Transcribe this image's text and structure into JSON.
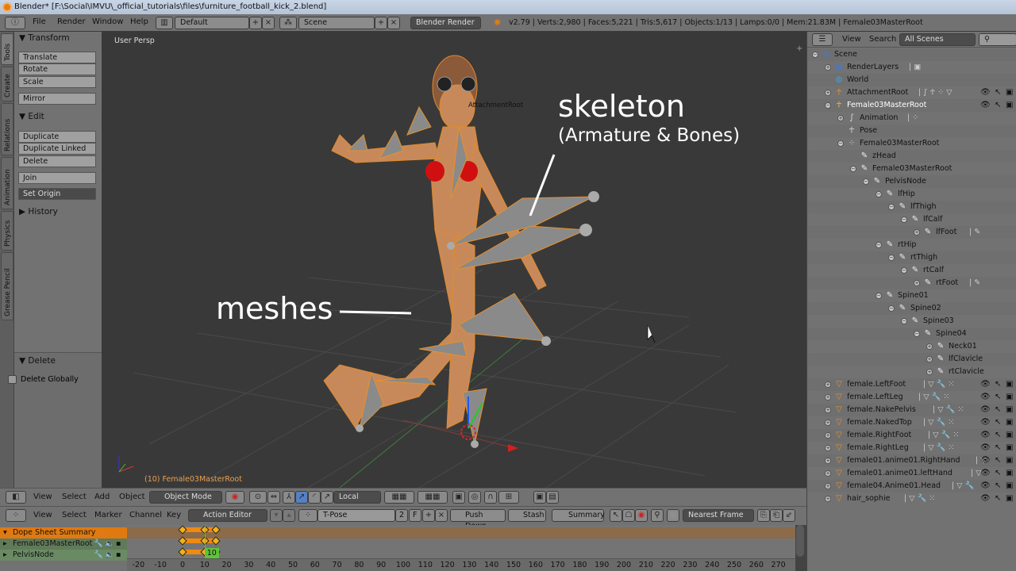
{
  "window": {
    "title": "Blender* [F:\\Social\\IMVU\\_official_tutorials\\files\\furniture_football_kick_2.blend]"
  },
  "infobar": {
    "menus": [
      "File",
      "Render",
      "Window",
      "Help"
    ],
    "screen_layout": "Default",
    "scene": "Scene",
    "render_engine": "Blender Render",
    "stats": "v2.79 | Verts:2,980 | Faces:5,221 | Tris:5,617 | Objects:1/13 | Lamps:0/0 | Mem:21.83M | Female03MasterRoot"
  },
  "tabs": [
    "Tools",
    "Create",
    "Relations",
    "Animation",
    "Physics",
    "Grease Pencil"
  ],
  "toolshelf": {
    "transform": {
      "title": "Transform",
      "buttons": [
        "Translate",
        "Rotate",
        "Scale"
      ],
      "mirror": "Mirror"
    },
    "edit": {
      "title": "Edit",
      "buttons": [
        "Duplicate",
        "Duplicate Linked",
        "Delete"
      ],
      "join": "Join",
      "set_origin": "Set Origin"
    },
    "history": {
      "title": "History"
    },
    "operator": {
      "title": "Delete",
      "checkbox_label": "Delete Globally",
      "checked": false
    }
  },
  "viewport": {
    "view_label": "User Persp",
    "object_label": "(10) Female03MasterRoot",
    "attachment_label": "AttachmentRoot",
    "annotations": {
      "skeleton": "skeleton",
      "skeleton_sub": "(Armature & Bones)",
      "meshes": "meshes"
    }
  },
  "view3d_header": {
    "menus": [
      "View",
      "Select",
      "Add",
      "Object"
    ],
    "mode": "Object Mode",
    "orientation": "Local"
  },
  "dopesheet_header": {
    "menus": [
      "View",
      "Select",
      "Marker",
      "Channel",
      "Key"
    ],
    "mode": "Action Editor",
    "action": "T-Pose",
    "users": "2",
    "fake_user": "F",
    "push_down": "Push Down",
    "stash": "Stash",
    "summary": "Summary",
    "snap": "Nearest Frame"
  },
  "dopesheet": {
    "channels": [
      {
        "name": "Dope Sheet Summary",
        "kind": "summary"
      },
      {
        "name": "Female03MasterRoot",
        "kind": "object"
      },
      {
        "name": "PelvisNode",
        "kind": "group"
      }
    ],
    "keyframes": [
      0,
      10,
      15
    ],
    "current_frame": "10",
    "ruler_ticks": [
      "-20",
      "-10",
      "0",
      "10",
      "20",
      "30",
      "40",
      "50",
      "60",
      "70",
      "80",
      "90",
      "100",
      "110",
      "120",
      "130",
      "140",
      "150",
      "160",
      "170",
      "180",
      "190",
      "200",
      "210",
      "220",
      "230",
      "240",
      "250",
      "260",
      "270"
    ]
  },
  "outliner": {
    "header": {
      "menus": [
        "View",
        "Search"
      ],
      "display": "All Scenes"
    },
    "rows": [
      {
        "label": "Scene",
        "level": 0,
        "icon": "scene",
        "exp": "-"
      },
      {
        "label": "RenderLayers",
        "level": 1,
        "icon": "renderlayers",
        "exp": "+",
        "extra": "| ▣"
      },
      {
        "label": "World",
        "level": 1,
        "icon": "world"
      },
      {
        "label": "AttachmentRoot",
        "level": 1,
        "icon": "armature",
        "exp": "+",
        "extra": "| ∫ ☥ ⁘ ▽",
        "vis": true
      },
      {
        "label": "Female03MasterRoot",
        "level": 1,
        "icon": "armature-active",
        "exp": "-",
        "vis": true,
        "active": true
      },
      {
        "label": "Animation",
        "level": 2,
        "icon": "animation",
        "exp": "+",
        "extra": "| ⁘"
      },
      {
        "label": "Pose",
        "level": 2,
        "icon": "pose"
      },
      {
        "label": "Female03MasterRoot",
        "level": 2,
        "icon": "armature-data",
        "exp": "-"
      },
      {
        "label": "zHead",
        "level": 3,
        "icon": "bone"
      },
      {
        "label": "Female03MasterRoot",
        "level": 3,
        "icon": "bone",
        "exp": "-"
      },
      {
        "label": "PelvisNode",
        "level": 4,
        "icon": "bone",
        "exp": "-"
      },
      {
        "label": "lfHip",
        "level": 5,
        "icon": "bone",
        "exp": "-"
      },
      {
        "label": "lfThigh",
        "level": 6,
        "icon": "bone",
        "exp": "-"
      },
      {
        "label": "lfCalf",
        "level": 7,
        "icon": "bone",
        "exp": "-"
      },
      {
        "label": "lfFoot",
        "level": 8,
        "icon": "bone",
        "exp": "+",
        "extra": "| ✎"
      },
      {
        "label": "rtHip",
        "level": 5,
        "icon": "bone",
        "exp": "-"
      },
      {
        "label": "rtThigh",
        "level": 6,
        "icon": "bone",
        "exp": "-"
      },
      {
        "label": "rtCalf",
        "level": 7,
        "icon": "bone",
        "exp": "-"
      },
      {
        "label": "rtFoot",
        "level": 8,
        "icon": "bone",
        "exp": "+",
        "extra": "| ✎"
      },
      {
        "label": "Spine01",
        "level": 5,
        "icon": "bone",
        "exp": "-"
      },
      {
        "label": "Spine02",
        "level": 6,
        "icon": "bone",
        "exp": "-"
      },
      {
        "label": "Spine03",
        "level": 7,
        "icon": "bone",
        "exp": "-"
      },
      {
        "label": "Spine04",
        "level": 8,
        "icon": "bone",
        "exp": "-"
      },
      {
        "label": "Neck01",
        "level": 9,
        "icon": "bone",
        "exp": "+"
      },
      {
        "label": "lfClavicle",
        "level": 9,
        "icon": "bone",
        "exp": "+"
      },
      {
        "label": "rtClavicle",
        "level": 9,
        "icon": "bone",
        "exp": "+"
      },
      {
        "label": "female.LeftFoot",
        "level": 1,
        "icon": "mesh",
        "exp": "+",
        "extra": "| ▽ 🔧 ⁙",
        "vis": true
      },
      {
        "label": "female.LeftLeg",
        "level": 1,
        "icon": "mesh",
        "exp": "+",
        "extra": "| ▽ 🔧 ⁙",
        "vis": true
      },
      {
        "label": "female.NakePelvis",
        "level": 1,
        "icon": "mesh",
        "exp": "+",
        "extra": "| ▽ 🔧 ⁙",
        "vis": true
      },
      {
        "label": "female.NakedTop",
        "level": 1,
        "icon": "mesh",
        "exp": "+",
        "extra": "| ▽ 🔧 ⁙",
        "vis": true
      },
      {
        "label": "female.RightFoot",
        "level": 1,
        "icon": "mesh",
        "exp": "+",
        "extra": "| ▽ 🔧 ⁙",
        "vis": true
      },
      {
        "label": "female.RightLeg",
        "level": 1,
        "icon": "mesh",
        "exp": "+",
        "extra": "| ▽ 🔧 ⁙",
        "vis": true
      },
      {
        "label": "female01.anime01.RightHand",
        "level": 1,
        "icon": "mesh",
        "exp": "+",
        "extra": "| ▽",
        "vis": true
      },
      {
        "label": "female01.anime01.leftHand",
        "level": 1,
        "icon": "mesh",
        "exp": "+",
        "extra": "| ▽",
        "vis": true
      },
      {
        "label": "female04.Anime01.Head",
        "level": 1,
        "icon": "mesh",
        "exp": "+",
        "extra": "| ▽ 🔧",
        "vis": true
      },
      {
        "label": "hair_sophie",
        "level": 1,
        "icon": "mesh",
        "exp": "+",
        "extra": "| ▽ 🔧 ⁙",
        "vis": true
      }
    ]
  },
  "colors": {
    "accent": "#e87d0d",
    "selection_outline": "#f09a2a",
    "summary_row": "#e07a10",
    "current_frame": "#5fc33a",
    "viewport_bg": "#393939"
  }
}
